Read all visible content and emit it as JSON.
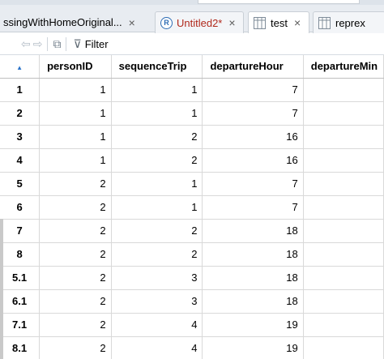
{
  "tabs": [
    {
      "label": "ssingWithHomeOriginal...",
      "close": "×"
    },
    {
      "label": "Untitled2*",
      "close": "×",
      "icon": "r-script-icon"
    },
    {
      "label": "test",
      "close": "×",
      "icon": "table-icon",
      "active": true
    },
    {
      "label": "reprex",
      "close": "×",
      "icon": "table-icon"
    }
  ],
  "toolbar": {
    "filter_label": "Filter",
    "back_glyph": "⇦",
    "forward_glyph": "⇨",
    "popout_glyph": "⧉",
    "filter_glyph": "⊽"
  },
  "table": {
    "sort_glyph": "▲",
    "columns": [
      "personID",
      "sequenceTrip",
      "departureHour",
      "departureMin"
    ],
    "rows": [
      {
        "name": "1",
        "cells": [
          "1",
          "1",
          "7"
        ]
      },
      {
        "name": "2",
        "cells": [
          "1",
          "1",
          "7"
        ]
      },
      {
        "name": "3",
        "cells": [
          "1",
          "2",
          "16"
        ]
      },
      {
        "name": "4",
        "cells": [
          "1",
          "2",
          "16"
        ]
      },
      {
        "name": "5",
        "cells": [
          "2",
          "1",
          "7"
        ]
      },
      {
        "name": "6",
        "cells": [
          "2",
          "1",
          "7"
        ]
      },
      {
        "name": "7",
        "cells": [
          "2",
          "2",
          "18"
        ]
      },
      {
        "name": "8",
        "cells": [
          "2",
          "2",
          "18"
        ]
      },
      {
        "name": "5.1",
        "cells": [
          "2",
          "3",
          "18"
        ]
      },
      {
        "name": "6.1",
        "cells": [
          "2",
          "3",
          "18"
        ]
      },
      {
        "name": "7.1",
        "cells": [
          "2",
          "4",
          "19"
        ]
      },
      {
        "name": "8.1",
        "cells": [
          "2",
          "4",
          "19"
        ]
      }
    ]
  },
  "colors": {
    "accent": "#2a73c9",
    "modified_tab": "#b0291c"
  }
}
